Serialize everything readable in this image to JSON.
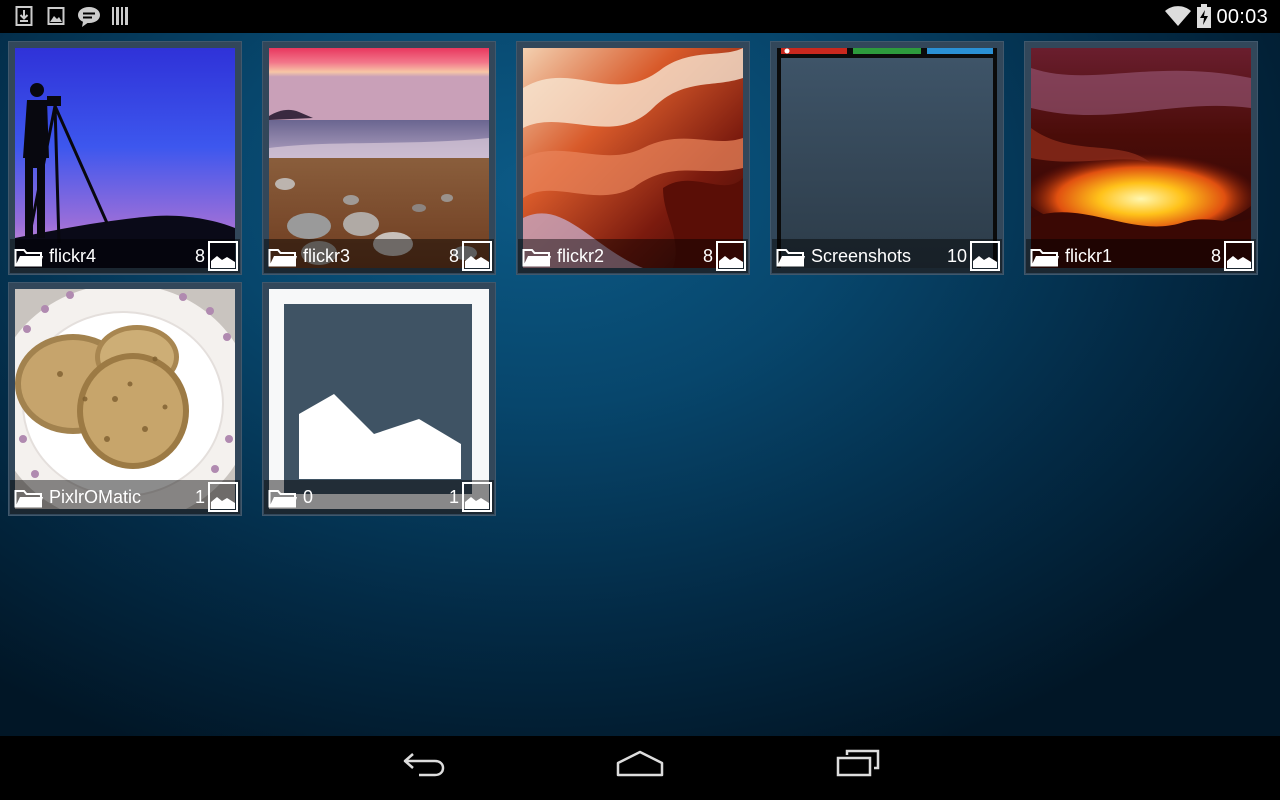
{
  "status_bar": {
    "left_icons": [
      "download-icon",
      "image-icon",
      "chat-bubble-icon",
      "barcode-icon"
    ],
    "right_icons": [
      "wifi-icon",
      "battery-charging-icon"
    ],
    "time": "00:03"
  },
  "albums": [
    {
      "name": "flickr4",
      "count": "8",
      "thumb": "photographer-silhouette-sunset"
    },
    {
      "name": "flickr3",
      "count": "8",
      "thumb": "beach-rocks-sunset"
    },
    {
      "name": "flickr2",
      "count": "8",
      "thumb": "red-sandstone-canyon"
    },
    {
      "name": "Screenshots",
      "count": "10",
      "thumb": "screenshot-preview"
    },
    {
      "name": "flickr1",
      "count": "8",
      "thumb": "glowing-slot-canyon"
    },
    {
      "name": "PixlrOMatic",
      "count": "1",
      "thumb": "flatbread-on-plate"
    },
    {
      "name": "0",
      "count": "1",
      "thumb": "image-placeholder"
    }
  ],
  "nav_bar": {
    "buttons": [
      "back-icon",
      "home-icon",
      "recent-apps-icon"
    ]
  },
  "colors": {
    "background_center": "#0c5a86",
    "background_edge": "#011626",
    "tile_frame": "#32475a"
  }
}
